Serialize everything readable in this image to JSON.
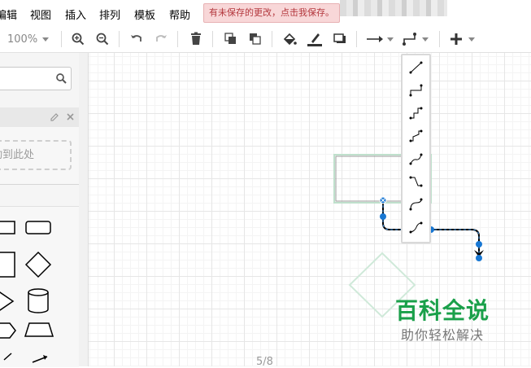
{
  "menubar": {
    "items": [
      {
        "label": "编辑"
      },
      {
        "label": "视图"
      },
      {
        "label": "插入"
      },
      {
        "label": "排列"
      },
      {
        "label": "模板"
      },
      {
        "label": "帮助"
      }
    ],
    "unsaved_notice": "有未保存的更改，点击我保存。"
  },
  "toolbar": {
    "zoom": "100%",
    "icons": [
      "zoom-in-icon",
      "zoom-out-icon",
      "undo-icon",
      "redo-icon",
      "delete-icon",
      "to-front-icon",
      "to-back-icon",
      "fill-color-icon",
      "line-color-icon",
      "shadow-icon",
      "connection-icon",
      "waypoints-icon",
      "insert-icon"
    ]
  },
  "sidebar": {
    "search_placeholder": "",
    "scratchpad_drop_hint": "拖动到此处"
  },
  "waypoint_menu": {
    "options": [
      "straight",
      "orthogonal",
      "simple",
      "isometric",
      "curved",
      "entity-relation",
      "curved-2",
      "curved-3"
    ],
    "selected": "orthogonal"
  },
  "footer": {
    "page_indicator": "5/8"
  },
  "watermark": {
    "title": "百科全说",
    "subtitle": "助你轻松解决"
  },
  "colors": {
    "accent": "#1a73e8",
    "handle": "#1877d3",
    "unsaved_bg": "#f8d7d8",
    "unsaved_text": "#b3373d",
    "watermark_green": "#1aa04a"
  }
}
